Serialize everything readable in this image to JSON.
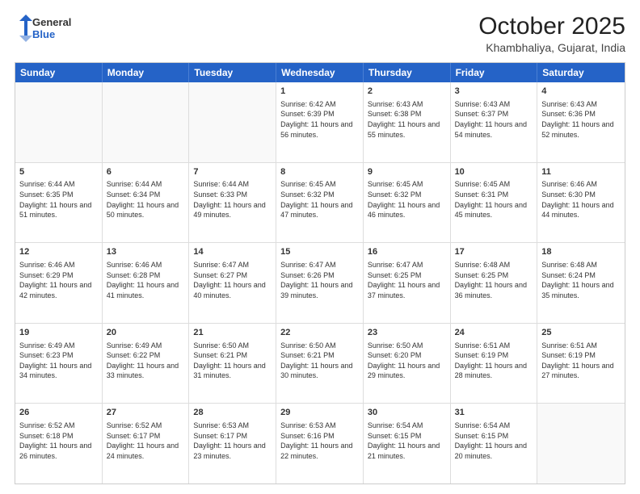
{
  "header": {
    "logo_general": "General",
    "logo_blue": "Blue",
    "month_title": "October 2025",
    "location": "Khambhaliya, Gujarat, India"
  },
  "weekdays": [
    "Sunday",
    "Monday",
    "Tuesday",
    "Wednesday",
    "Thursday",
    "Friday",
    "Saturday"
  ],
  "rows": [
    [
      {
        "day": "",
        "info": ""
      },
      {
        "day": "",
        "info": ""
      },
      {
        "day": "",
        "info": ""
      },
      {
        "day": "1",
        "info": "Sunrise: 6:42 AM\nSunset: 6:39 PM\nDaylight: 11 hours and 56 minutes."
      },
      {
        "day": "2",
        "info": "Sunrise: 6:43 AM\nSunset: 6:38 PM\nDaylight: 11 hours and 55 minutes."
      },
      {
        "day": "3",
        "info": "Sunrise: 6:43 AM\nSunset: 6:37 PM\nDaylight: 11 hours and 54 minutes."
      },
      {
        "day": "4",
        "info": "Sunrise: 6:43 AM\nSunset: 6:36 PM\nDaylight: 11 hours and 52 minutes."
      }
    ],
    [
      {
        "day": "5",
        "info": "Sunrise: 6:44 AM\nSunset: 6:35 PM\nDaylight: 11 hours and 51 minutes."
      },
      {
        "day": "6",
        "info": "Sunrise: 6:44 AM\nSunset: 6:34 PM\nDaylight: 11 hours and 50 minutes."
      },
      {
        "day": "7",
        "info": "Sunrise: 6:44 AM\nSunset: 6:33 PM\nDaylight: 11 hours and 49 minutes."
      },
      {
        "day": "8",
        "info": "Sunrise: 6:45 AM\nSunset: 6:32 PM\nDaylight: 11 hours and 47 minutes."
      },
      {
        "day": "9",
        "info": "Sunrise: 6:45 AM\nSunset: 6:32 PM\nDaylight: 11 hours and 46 minutes."
      },
      {
        "day": "10",
        "info": "Sunrise: 6:45 AM\nSunset: 6:31 PM\nDaylight: 11 hours and 45 minutes."
      },
      {
        "day": "11",
        "info": "Sunrise: 6:46 AM\nSunset: 6:30 PM\nDaylight: 11 hours and 44 minutes."
      }
    ],
    [
      {
        "day": "12",
        "info": "Sunrise: 6:46 AM\nSunset: 6:29 PM\nDaylight: 11 hours and 42 minutes."
      },
      {
        "day": "13",
        "info": "Sunrise: 6:46 AM\nSunset: 6:28 PM\nDaylight: 11 hours and 41 minutes."
      },
      {
        "day": "14",
        "info": "Sunrise: 6:47 AM\nSunset: 6:27 PM\nDaylight: 11 hours and 40 minutes."
      },
      {
        "day": "15",
        "info": "Sunrise: 6:47 AM\nSunset: 6:26 PM\nDaylight: 11 hours and 39 minutes."
      },
      {
        "day": "16",
        "info": "Sunrise: 6:47 AM\nSunset: 6:25 PM\nDaylight: 11 hours and 37 minutes."
      },
      {
        "day": "17",
        "info": "Sunrise: 6:48 AM\nSunset: 6:25 PM\nDaylight: 11 hours and 36 minutes."
      },
      {
        "day": "18",
        "info": "Sunrise: 6:48 AM\nSunset: 6:24 PM\nDaylight: 11 hours and 35 minutes."
      }
    ],
    [
      {
        "day": "19",
        "info": "Sunrise: 6:49 AM\nSunset: 6:23 PM\nDaylight: 11 hours and 34 minutes."
      },
      {
        "day": "20",
        "info": "Sunrise: 6:49 AM\nSunset: 6:22 PM\nDaylight: 11 hours and 33 minutes."
      },
      {
        "day": "21",
        "info": "Sunrise: 6:50 AM\nSunset: 6:21 PM\nDaylight: 11 hours and 31 minutes."
      },
      {
        "day": "22",
        "info": "Sunrise: 6:50 AM\nSunset: 6:21 PM\nDaylight: 11 hours and 30 minutes."
      },
      {
        "day": "23",
        "info": "Sunrise: 6:50 AM\nSunset: 6:20 PM\nDaylight: 11 hours and 29 minutes."
      },
      {
        "day": "24",
        "info": "Sunrise: 6:51 AM\nSunset: 6:19 PM\nDaylight: 11 hours and 28 minutes."
      },
      {
        "day": "25",
        "info": "Sunrise: 6:51 AM\nSunset: 6:19 PM\nDaylight: 11 hours and 27 minutes."
      }
    ],
    [
      {
        "day": "26",
        "info": "Sunrise: 6:52 AM\nSunset: 6:18 PM\nDaylight: 11 hours and 26 minutes."
      },
      {
        "day": "27",
        "info": "Sunrise: 6:52 AM\nSunset: 6:17 PM\nDaylight: 11 hours and 24 minutes."
      },
      {
        "day": "28",
        "info": "Sunrise: 6:53 AM\nSunset: 6:17 PM\nDaylight: 11 hours and 23 minutes."
      },
      {
        "day": "29",
        "info": "Sunrise: 6:53 AM\nSunset: 6:16 PM\nDaylight: 11 hours and 22 minutes."
      },
      {
        "day": "30",
        "info": "Sunrise: 6:54 AM\nSunset: 6:15 PM\nDaylight: 11 hours and 21 minutes."
      },
      {
        "day": "31",
        "info": "Sunrise: 6:54 AM\nSunset: 6:15 PM\nDaylight: 11 hours and 20 minutes."
      },
      {
        "day": "",
        "info": ""
      }
    ]
  ]
}
